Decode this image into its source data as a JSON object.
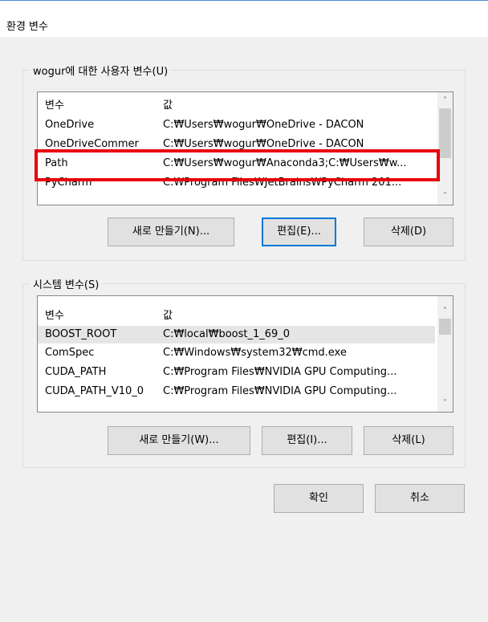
{
  "dialog": {
    "title": "환경 변수"
  },
  "user_vars": {
    "group_label": "wogur에 대한 사용자 변수(U)",
    "columns": [
      "변수",
      "값"
    ],
    "rows": [
      {
        "name": "OneDrive",
        "value": "C:₩Users₩wogur₩OneDrive - DACON"
      },
      {
        "name": "OneDriveCommer",
        "value": "C:₩Users₩wogur₩OneDrive - DACON"
      },
      {
        "name": "Path",
        "value": "C:₩Users₩wogur₩Anaconda3;C:₩Users₩w..."
      },
      {
        "name": "PyCharm",
        "value": "C:₩Program Files₩JetBrains₩PyCharm 201..."
      }
    ],
    "buttons": {
      "new": "새로 만들기(N)...",
      "edit": "편집(E)...",
      "delete": "삭제(D)"
    }
  },
  "system_vars": {
    "group_label": "시스템 변수(S)",
    "columns": [
      "변수",
      "값"
    ],
    "rows": [
      {
        "name": "BOOST_ROOT",
        "value": "C:₩local₩boost_1_69_0"
      },
      {
        "name": "ComSpec",
        "value": "C:₩Windows₩system32₩cmd.exe"
      },
      {
        "name": "CUDA_PATH",
        "value": "C:₩Program Files₩NVIDIA GPU Computing..."
      },
      {
        "name": "CUDA_PATH_V10_0",
        "value": "C:₩Program Files₩NVIDIA GPU Computing..."
      }
    ],
    "buttons": {
      "new": "새로 만들기(W)...",
      "edit": "편집(I)...",
      "delete": "삭제(L)"
    }
  },
  "footer": {
    "ok": "확인",
    "cancel": "취소"
  },
  "colors": {
    "highlight": "#e8000b",
    "default_button_border": "#0078d7"
  },
  "icons": {
    "scroll_up": "chevron-up-icon",
    "scroll_down": "chevron-down-icon"
  }
}
